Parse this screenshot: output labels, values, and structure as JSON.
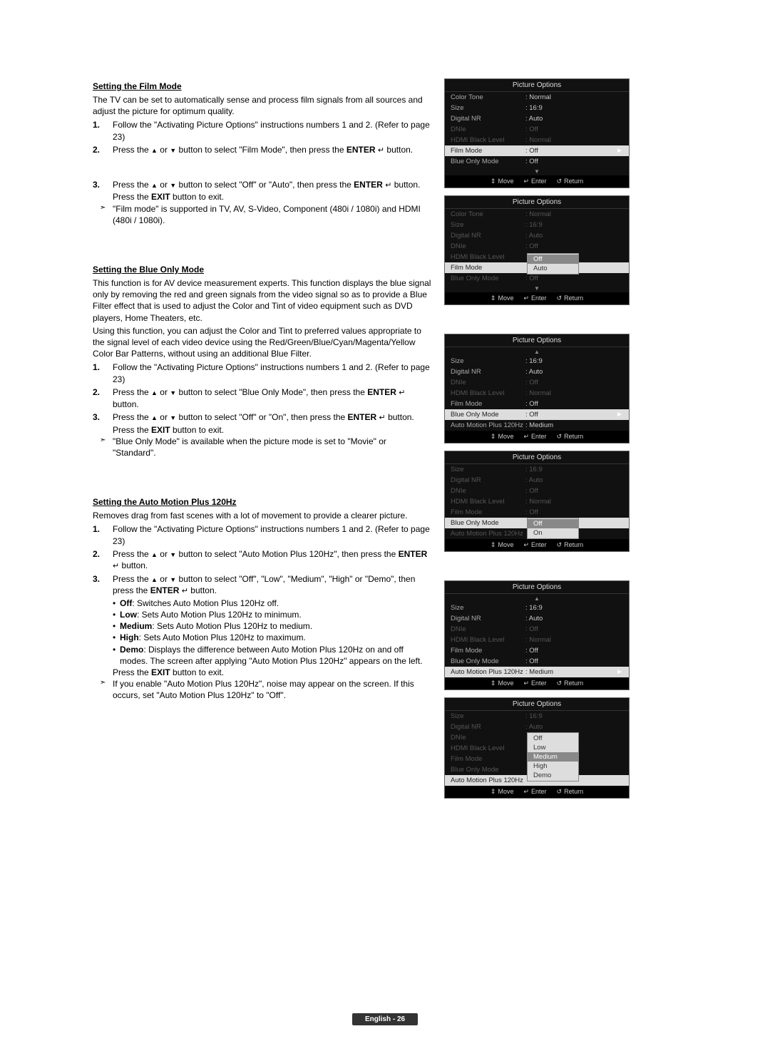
{
  "footer": {
    "text": "English - 26"
  },
  "sections": {
    "film": {
      "title": "Setting the Film Mode",
      "intro": "The TV can be set to automatically sense and process film signals from all sources and adjust the picture for optimum quality.",
      "step1": "Follow the \"Activating Picture Options\" instructions numbers 1 and 2. (Refer to page 23)",
      "step2_a": "Press the ",
      "step2_b": " or ",
      "step2_c": " button to select \"Film Mode\", then press the ",
      "step2_enter": "ENTER",
      "step2_d": " button.",
      "step3_a": "Press the ",
      "step3_b": " or ",
      "step3_c": " button to select \"Off\" or \"Auto\", then press the ",
      "step3_enter": "ENTER",
      "step3_d": " button.",
      "exit_a": "Press the ",
      "exit_b": "EXIT",
      "exit_c": " button to exit.",
      "note": "\"Film mode\" is supported in TV, AV, S-Video, Component (480i / 1080i) and HDMI (480i / 1080i)."
    },
    "blue": {
      "title": "Setting the Blue Only Mode",
      "para1": "This function is for AV device measurement experts. This function displays the blue signal only by removing the red and green signals from the video signal so as to provide a Blue Filter effect that is used to adjust the Color and Tint of video equipment such as DVD players, Home Theaters, etc.",
      "para2": "Using this function, you can adjust the Color and Tint to preferred values appropriate to the signal level of each video device using the Red/Green/Blue/Cyan/Magenta/Yellow Color Bar Patterns, without using an additional Blue Filter.",
      "step1": "Follow the \"Activating Picture Options\" instructions numbers 1 and 2. (Refer to page 23)",
      "step2_a": "Press the ",
      "step2_b": " or ",
      "step2_c": " button to select \"Blue Only Mode\", then press the ",
      "step2_enter": "ENTER",
      "step2_d": " button.",
      "step3_a": "Press the ",
      "step3_b": " or ",
      "step3_c": " button to select \"Off\" or \"On\", then press the ",
      "step3_enter": "ENTER",
      "step3_d": " button.",
      "exit_a": "Press the ",
      "exit_b": "EXIT",
      "exit_c": " button to exit.",
      "note": "\"Blue Only Mode\" is available when the picture mode is set to \"Movie\" or \"Standard\"."
    },
    "amp": {
      "title": "Setting the Auto Motion Plus 120Hz",
      "intro": "Removes drag from fast scenes with a lot of movement to provide a clearer picture.",
      "step1": "Follow the \"Activating Picture Options\" instructions numbers 1 and 2. (Refer to page 23)",
      "step2_a": "Press the ",
      "step2_b": " or ",
      "step2_c": " button to select \"Auto Motion Plus 120Hz\", then press the ",
      "step2_enter": "ENTER",
      "step2_d": " button.",
      "step3_a": "Press the ",
      "step3_b": " or ",
      "step3_c": " button to select \"Off\", \"Low\", \"Medium\", \"High\" or \"Demo\", then press the ",
      "step3_enter": "ENTER",
      "step3_d": " button.",
      "b_off_l": "Off",
      "b_off_t": ": Switches Auto Motion Plus 120Hz off.",
      "b_low_l": "Low",
      "b_low_t": ": Sets Auto Motion Plus 120Hz to minimum.",
      "b_med_l": "Medium",
      "b_med_t": ": Sets Auto Motion Plus 120Hz to medium.",
      "b_high_l": "High",
      "b_high_t": ": Sets Auto Motion Plus 120Hz to maximum.",
      "b_demo_l": "Demo",
      "b_demo_t": ": Displays the difference between Auto Motion Plus 120Hz on and off modes. The screen after applying \"Auto Motion Plus 120Hz\" appears on the left.",
      "exit_a": "Press the ",
      "exit_b": "EXIT",
      "exit_c": " button to exit.",
      "note": "If you enable \"Auto Motion Plus 120Hz\", noise may appear on the screen. If this occurs, set \"Auto Motion Plus 120Hz\" to \"Off\"."
    }
  },
  "osd": {
    "title": "Picture Options",
    "footer": {
      "move": "Move",
      "enter": "Enter",
      "return": "Return"
    },
    "labels": {
      "color_tone": "Color Tone",
      "size": "Size",
      "digital_nr": "Digital NR",
      "dnie": "DNIe",
      "hdmi_black": "HDMI Black Level",
      "film_mode": "Film Mode",
      "blue_only": "Blue Only Mode",
      "amp": "Auto Motion Plus 120Hz"
    },
    "vals": {
      "normal": ": Normal",
      "ratio": ": 16:9",
      "auto": ": Auto",
      "off": ": Off",
      "medium": ": Medium"
    },
    "popup": {
      "off": "Off",
      "auto": "Auto",
      "on": "On",
      "low": "Low",
      "medium": "Medium",
      "high": "High",
      "demo": "Demo"
    }
  }
}
